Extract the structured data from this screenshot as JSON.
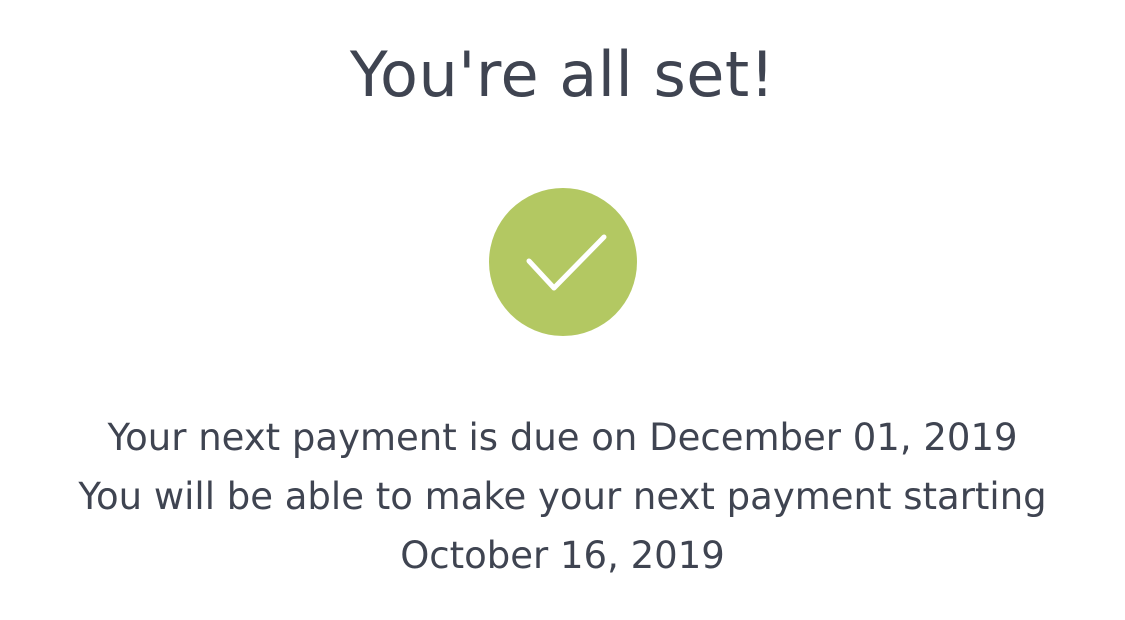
{
  "title": "You're all set!",
  "icons": {
    "success": "checkmark-circle-icon"
  },
  "colors": {
    "success_circle": "#b3c862",
    "checkmark": "#ffffff",
    "text": "#3f4451",
    "background": "#ffffff"
  },
  "message": {
    "line1": "Your next payment is due on December 01, 2019",
    "line2": "You will be able to make your next payment starting",
    "line3": "October 16, 2019"
  }
}
